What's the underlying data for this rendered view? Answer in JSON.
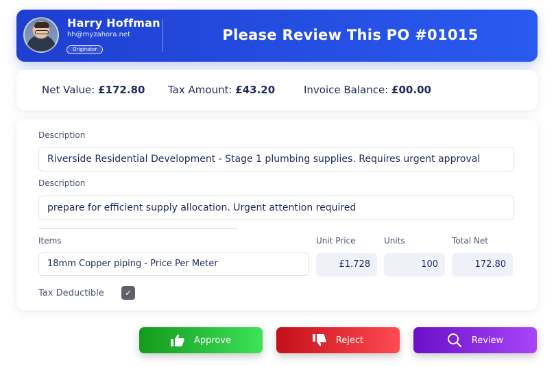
{
  "header": {
    "user_name": "Harry Hoffman",
    "user_email": "hh@myzahora.net",
    "role_badge": "Originator",
    "title": "Please Review This PO #01015",
    "gradient_start": "#1e3fd0",
    "gradient_end": "#2a5af0"
  },
  "summary": {
    "net_value_label": "Net Value:",
    "net_value": "£172.80",
    "tax_amount_label": "Tax Amount:",
    "tax_amount": "£43.20",
    "invoice_balance_label": "Invoice Balance:",
    "invoice_balance": "£00.00"
  },
  "details": {
    "description_label_1": "Description",
    "description_value_1": "Riverside Residential Development - Stage 1 plumbing supplies. Requires urgent approval",
    "description_label_2": "Description",
    "description_value_2": "prepare for efficient supply allocation. Urgent attention required",
    "columns": {
      "items": "Items",
      "unit_price": "Unit Price",
      "units": "Units",
      "total_net": "Total Net"
    },
    "line_item": {
      "item": "18mm Copper piping - Price Per Meter",
      "unit_price": "£1.728",
      "units": "100",
      "total_net": "172.80"
    },
    "tax_deductible_label": "Tax Deductible",
    "tax_deductible_checked": true
  },
  "actions": {
    "approve_label": "Approve",
    "reject_label": "Reject",
    "review_label": "Review",
    "approve_icon": "thumbs-up-icon",
    "reject_icon": "thumbs-down-icon",
    "review_icon": "search-icon",
    "approve_color": "#139a1d",
    "reject_color": "#c4101a",
    "review_color": "#6a10c8"
  }
}
